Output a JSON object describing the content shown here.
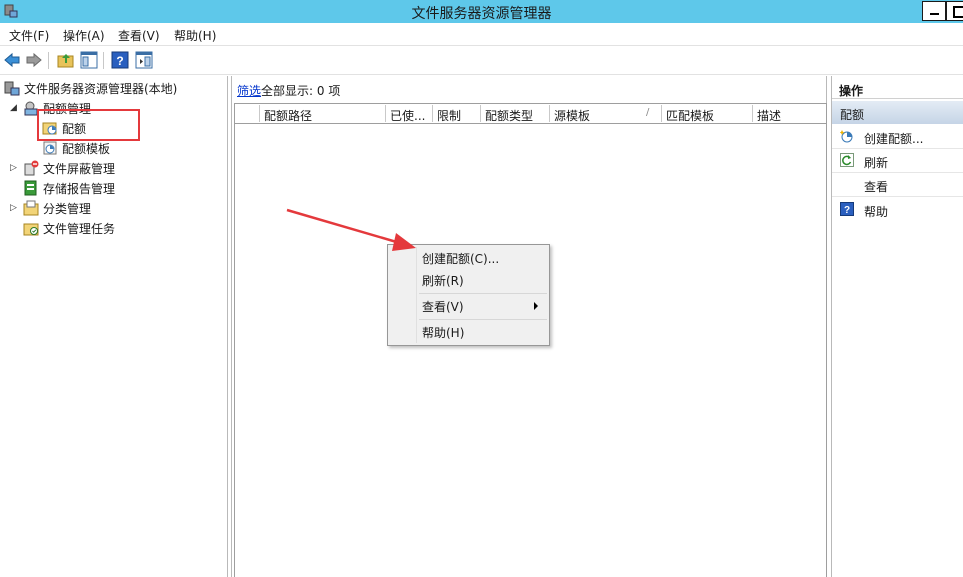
{
  "window": {
    "title": "文件服务器资源管理器"
  },
  "menubar": {
    "items": [
      "文件(F)",
      "操作(A)",
      "查看(V)",
      "帮助(H)"
    ]
  },
  "toolbar": {
    "buttons": [
      "back-icon",
      "forward-icon",
      "up-folder-icon",
      "show-hide-console-tree-icon",
      "help-icon",
      "show-hide-action-pane-icon"
    ]
  },
  "tree": {
    "root": "文件服务器资源管理器(本地)",
    "quota_mgmt": "配额管理",
    "quota": "配额",
    "quota_template": "配额模板",
    "file_screen": "文件屏蔽管理",
    "storage_report": "存储报告管理",
    "classification": "分类管理",
    "file_mgmt_tasks": "文件管理任务"
  },
  "center": {
    "filter_link": "筛选",
    "filter_text": "全部显示: 0 项",
    "columns": [
      "配额路径",
      "已使...",
      "限制",
      "配额类型",
      "源模板",
      "匹配模板",
      "描述"
    ]
  },
  "context_menu": {
    "create_quota": "创建配额(C)...",
    "refresh": "刷新(R)",
    "view": "查看(V)",
    "help": "帮助(H)"
  },
  "actions": {
    "header": "操作",
    "section": "配额",
    "items": [
      "创建配额...",
      "刷新",
      "查看",
      "帮助"
    ]
  },
  "colors": {
    "titlebar": "#5ec8ea",
    "highlight_box": "#e4393c",
    "arrow": "#e4393c",
    "section_bg": "#c5d4e6"
  }
}
